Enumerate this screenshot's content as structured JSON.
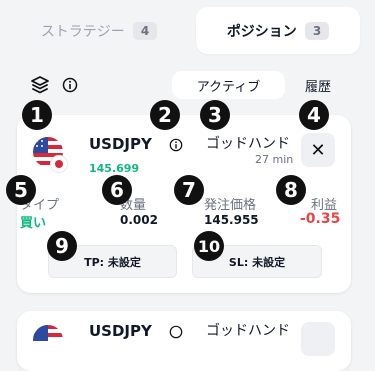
{
  "tabs": [
    {
      "label": "ストラテジー",
      "count": "4"
    },
    {
      "label": "ポジション",
      "count": "3"
    }
  ],
  "toolbar": {
    "layers_icon": "layers-icon",
    "info_icon": "info-icon",
    "subtabs": [
      {
        "label": "アクティブ"
      },
      {
        "label": "履歴"
      }
    ]
  },
  "annotations": [
    "1",
    "2",
    "3",
    "4",
    "5",
    "6",
    "7",
    "8",
    "9",
    "10"
  ],
  "positions": [
    {
      "symbol": "USDJPY",
      "current_price": "145.699",
      "strategy": "ゴッドハンド",
      "elapsed": "27 min",
      "close": "✕",
      "type_label": "タイプ",
      "type_value": "買い",
      "qty_label": "数量",
      "qty_value": "0.002",
      "order_price_label": "発注価格",
      "order_price_value": "145.955",
      "profit_label": "利益",
      "profit_value": "-0.35",
      "tp_label": "TP: 未設定",
      "sl_label": "SL: 未設定"
    },
    {
      "symbol": "USDJPY",
      "strategy": "ゴッドハンド"
    }
  ],
  "colors": {
    "price_green": "#10b981",
    "loss_red": "#ef4444",
    "background": "#f3f4f6"
  }
}
